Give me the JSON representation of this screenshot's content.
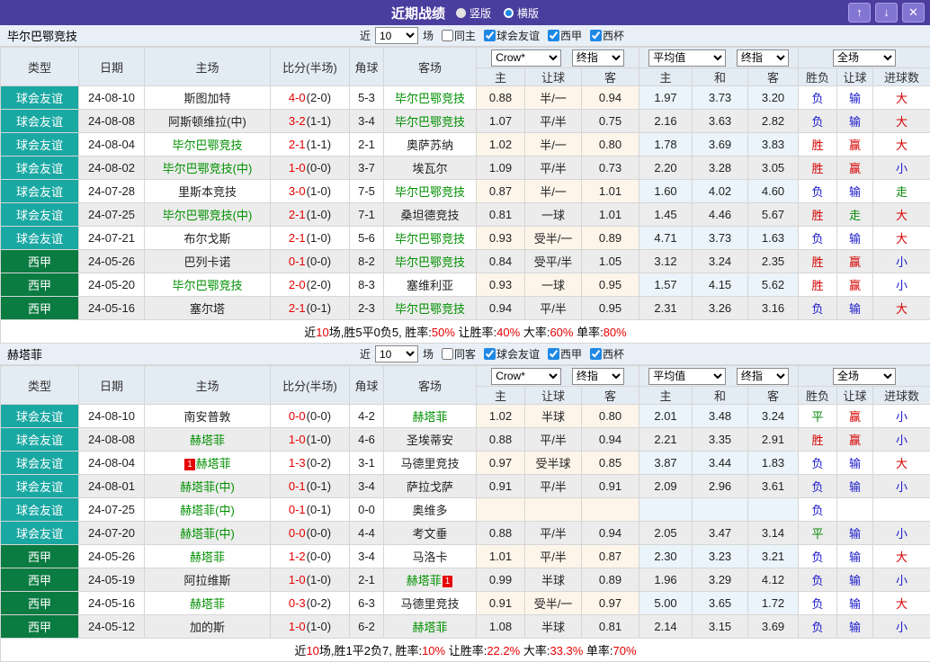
{
  "titlebar": {
    "title": "近期战绩",
    "view_options": [
      {
        "label": "竖版",
        "selected": false
      },
      {
        "label": "横版",
        "selected": true
      }
    ],
    "buttons": {
      "up": "↑",
      "down": "↓",
      "close": "✕"
    }
  },
  "filters": {
    "near_label": "近",
    "count": "10",
    "games_label": "场",
    "leagues": [
      "球会友谊",
      "西甲",
      "西杯"
    ]
  },
  "headers": {
    "columns": [
      "类型",
      "日期",
      "主场",
      "比分(半场)",
      "角球",
      "客场",
      "主",
      "让球",
      "客",
      "主",
      "和",
      "客",
      "胜负",
      "让球",
      "进球数"
    ],
    "selects": {
      "book": "Crow*",
      "book_final": "终指",
      "avg": "平均值",
      "avg_final": "终指",
      "scope": "全场"
    }
  },
  "colors": {
    "titlebar_bg": "#4a3d9e",
    "accent_blue": "#1e88e5",
    "team_link_green": "#009000",
    "score_red": "#e60000",
    "result_red": "#d60000",
    "result_blue": "#1a1acc",
    "result_green": "#0a8a0a"
  },
  "league_colors": {
    "球会友谊": "#1aa8a3",
    "西甲": "#0a7b41"
  },
  "teams": [
    {
      "name": "毕尔巴鄂竞技",
      "same_label": "同主",
      "rows": [
        {
          "league": "球会友谊",
          "date": "24-08-10",
          "home": "斯图加特",
          "hg": false,
          "hb": "",
          "ft": "4-0",
          "ht": "(2-0)",
          "corner": "5-3",
          "away": "毕尔巴鄂竞技",
          "ag": true,
          "ab": "",
          "odds": [
            "0.88",
            "半/一",
            "0.94"
          ],
          "avg": [
            "1.97",
            "3.73",
            "3.20"
          ],
          "res": [
            [
              "负",
              "blue"
            ],
            [
              "输",
              "blue"
            ],
            [
              "大",
              "red"
            ]
          ]
        },
        {
          "league": "球会友谊",
          "date": "24-08-08",
          "home": "阿斯顿维拉(中)",
          "hg": false,
          "hb": "",
          "ft": "3-2",
          "ht": "(1-1)",
          "corner": "3-4",
          "away": "毕尔巴鄂竞技",
          "ag": true,
          "ab": "",
          "odds": [
            "1.07",
            "平/半",
            "0.75"
          ],
          "avg": [
            "2.16",
            "3.63",
            "2.82"
          ],
          "res": [
            [
              "负",
              "blue"
            ],
            [
              "输",
              "blue"
            ],
            [
              "大",
              "red"
            ]
          ]
        },
        {
          "league": "球会友谊",
          "date": "24-08-04",
          "home": "毕尔巴鄂竞技",
          "hg": true,
          "hb": "",
          "ft": "2-1",
          "ht": "(1-1)",
          "corner": "2-1",
          "away": "奥萨苏纳",
          "ag": false,
          "ab": "",
          "odds": [
            "1.02",
            "半/一",
            "0.80"
          ],
          "avg": [
            "1.78",
            "3.69",
            "3.83"
          ],
          "res": [
            [
              "胜",
              "red"
            ],
            [
              "赢",
              "red"
            ],
            [
              "大",
              "red"
            ]
          ]
        },
        {
          "league": "球会友谊",
          "date": "24-08-02",
          "home": "毕尔巴鄂竞技(中)",
          "hg": true,
          "hb": "",
          "ft": "1-0",
          "ht": "(0-0)",
          "corner": "3-7",
          "away": "埃瓦尔",
          "ag": false,
          "ab": "",
          "odds": [
            "1.09",
            "平/半",
            "0.73"
          ],
          "avg": [
            "2.20",
            "3.28",
            "3.05"
          ],
          "res": [
            [
              "胜",
              "red"
            ],
            [
              "赢",
              "red"
            ],
            [
              "小",
              "blue"
            ]
          ]
        },
        {
          "league": "球会友谊",
          "date": "24-07-28",
          "home": "里斯本竞技",
          "hg": false,
          "hb": "",
          "ft": "3-0",
          "ht": "(1-0)",
          "corner": "7-5",
          "away": "毕尔巴鄂竞技",
          "ag": true,
          "ab": "",
          "odds": [
            "0.87",
            "半/一",
            "1.01"
          ],
          "avg": [
            "1.60",
            "4.02",
            "4.60"
          ],
          "res": [
            [
              "负",
              "blue"
            ],
            [
              "输",
              "blue"
            ],
            [
              "走",
              "green"
            ]
          ]
        },
        {
          "league": "球会友谊",
          "date": "24-07-25",
          "home": "毕尔巴鄂竞技(中)",
          "hg": true,
          "hb": "",
          "ft": "2-1",
          "ht": "(1-0)",
          "corner": "7-1",
          "away": "桑坦德竞技",
          "ag": false,
          "ab": "",
          "odds": [
            "0.81",
            "一球",
            "1.01"
          ],
          "avg": [
            "1.45",
            "4.46",
            "5.67"
          ],
          "res": [
            [
              "胜",
              "red"
            ],
            [
              "走",
              "green"
            ],
            [
              "大",
              "red"
            ]
          ]
        },
        {
          "league": "球会友谊",
          "date": "24-07-21",
          "home": "布尔戈斯",
          "hg": false,
          "hb": "",
          "ft": "2-1",
          "ht": "(1-0)",
          "corner": "5-6",
          "away": "毕尔巴鄂竞技",
          "ag": true,
          "ab": "",
          "odds": [
            "0.93",
            "受半/一",
            "0.89"
          ],
          "avg": [
            "4.71",
            "3.73",
            "1.63"
          ],
          "res": [
            [
              "负",
              "blue"
            ],
            [
              "输",
              "blue"
            ],
            [
              "大",
              "red"
            ]
          ]
        },
        {
          "league": "西甲",
          "date": "24-05-26",
          "home": "巴列卡诺",
          "hg": false,
          "hb": "",
          "ft": "0-1",
          "ht": "(0-0)",
          "corner": "8-2",
          "away": "毕尔巴鄂竞技",
          "ag": true,
          "ab": "",
          "odds": [
            "0.84",
            "受平/半",
            "1.05"
          ],
          "avg": [
            "3.12",
            "3.24",
            "2.35"
          ],
          "res": [
            [
              "胜",
              "red"
            ],
            [
              "赢",
              "red"
            ],
            [
              "小",
              "blue"
            ]
          ]
        },
        {
          "league": "西甲",
          "date": "24-05-20",
          "home": "毕尔巴鄂竞技",
          "hg": true,
          "hb": "",
          "ft": "2-0",
          "ht": "(2-0)",
          "corner": "8-3",
          "away": "塞维利亚",
          "ag": false,
          "ab": "",
          "odds": [
            "0.93",
            "一球",
            "0.95"
          ],
          "avg": [
            "1.57",
            "4.15",
            "5.62"
          ],
          "res": [
            [
              "胜",
              "red"
            ],
            [
              "赢",
              "red"
            ],
            [
              "小",
              "blue"
            ]
          ]
        },
        {
          "league": "西甲",
          "date": "24-05-16",
          "home": "塞尔塔",
          "hg": false,
          "hb": "",
          "ft": "2-1",
          "ht": "(0-1)",
          "corner": "2-3",
          "away": "毕尔巴鄂竞技",
          "ag": true,
          "ab": "",
          "odds": [
            "0.94",
            "平/半",
            "0.95"
          ],
          "avg": [
            "2.31",
            "3.26",
            "3.16"
          ],
          "res": [
            [
              "负",
              "blue"
            ],
            [
              "输",
              "blue"
            ],
            [
              "大",
              "red"
            ]
          ]
        }
      ],
      "summary": [
        [
          "近",
          0
        ],
        [
          "10",
          1
        ],
        [
          "场,胜5平0负5, 胜率:",
          0
        ],
        [
          "50%",
          1
        ],
        [
          " 让胜率:",
          0
        ],
        [
          "40%",
          1
        ],
        [
          " 大率:",
          0
        ],
        [
          "60%",
          1
        ],
        [
          " 单率:",
          0
        ],
        [
          "80%",
          1
        ]
      ]
    },
    {
      "name": "赫塔菲",
      "same_label": "同客",
      "rows": [
        {
          "league": "球会友谊",
          "date": "24-08-10",
          "home": "南安普敦",
          "hg": false,
          "hb": "",
          "ft": "0-0",
          "ht": "(0-0)",
          "corner": "4-2",
          "away": "赫塔菲",
          "ag": true,
          "ab": "",
          "odds": [
            "1.02",
            "半球",
            "0.80"
          ],
          "avg": [
            "2.01",
            "3.48",
            "3.24"
          ],
          "res": [
            [
              "平",
              "green"
            ],
            [
              "赢",
              "red"
            ],
            [
              "小",
              "blue"
            ]
          ]
        },
        {
          "league": "球会友谊",
          "date": "24-08-08",
          "home": "赫塔菲",
          "hg": true,
          "hb": "",
          "ft": "1-0",
          "ht": "(1-0)",
          "corner": "4-6",
          "away": "圣埃蒂安",
          "ag": false,
          "ab": "",
          "odds": [
            "0.88",
            "平/半",
            "0.94"
          ],
          "avg": [
            "2.21",
            "3.35",
            "2.91"
          ],
          "res": [
            [
              "胜",
              "red"
            ],
            [
              "赢",
              "red"
            ],
            [
              "小",
              "blue"
            ]
          ]
        },
        {
          "league": "球会友谊",
          "date": "24-08-04",
          "home": "赫塔菲",
          "hg": true,
          "hb": "1",
          "ft": "1-3",
          "ht": "(0-2)",
          "corner": "3-1",
          "away": "马德里竞技",
          "ag": false,
          "ab": "",
          "odds": [
            "0.97",
            "受半球",
            "0.85"
          ],
          "avg": [
            "3.87",
            "3.44",
            "1.83"
          ],
          "res": [
            [
              "负",
              "blue"
            ],
            [
              "输",
              "blue"
            ],
            [
              "大",
              "red"
            ]
          ]
        },
        {
          "league": "球会友谊",
          "date": "24-08-01",
          "home": "赫塔菲(中)",
          "hg": true,
          "hb": "",
          "ft": "0-1",
          "ht": "(0-1)",
          "corner": "3-4",
          "away": "萨拉戈萨",
          "ag": false,
          "ab": "",
          "odds": [
            "0.91",
            "平/半",
            "0.91"
          ],
          "avg": [
            "2.09",
            "2.96",
            "3.61"
          ],
          "res": [
            [
              "负",
              "blue"
            ],
            [
              "输",
              "blue"
            ],
            [
              "小",
              "blue"
            ]
          ]
        },
        {
          "league": "球会友谊",
          "date": "24-07-25",
          "home": "赫塔菲(中)",
          "hg": true,
          "hb": "",
          "ft": "0-1",
          "ht": "(0-1)",
          "corner": "0-0",
          "away": "奥维多",
          "ag": false,
          "ab": "",
          "odds": [
            "",
            "",
            ""
          ],
          "avg": [
            "",
            "",
            ""
          ],
          "res": [
            [
              "负",
              "blue"
            ],
            [
              "",
              ""
            ],
            [
              "",
              ""
            ]
          ]
        },
        {
          "league": "球会友谊",
          "date": "24-07-20",
          "home": "赫塔菲(中)",
          "hg": true,
          "hb": "",
          "ft": "0-0",
          "ht": "(0-0)",
          "corner": "4-4",
          "away": "考文垂",
          "ag": false,
          "ab": "",
          "odds": [
            "0.88",
            "平/半",
            "0.94"
          ],
          "avg": [
            "2.05",
            "3.47",
            "3.14"
          ],
          "res": [
            [
              "平",
              "green"
            ],
            [
              "输",
              "blue"
            ],
            [
              "小",
              "blue"
            ]
          ]
        },
        {
          "league": "西甲",
          "date": "24-05-26",
          "home": "赫塔菲",
          "hg": true,
          "hb": "",
          "ft": "1-2",
          "ht": "(0-0)",
          "corner": "3-4",
          "away": "马洛卡",
          "ag": false,
          "ab": "",
          "odds": [
            "1.01",
            "平/半",
            "0.87"
          ],
          "avg": [
            "2.30",
            "3.23",
            "3.21"
          ],
          "res": [
            [
              "负",
              "blue"
            ],
            [
              "输",
              "blue"
            ],
            [
              "大",
              "red"
            ]
          ]
        },
        {
          "league": "西甲",
          "date": "24-05-19",
          "home": "阿拉维斯",
          "hg": false,
          "hb": "",
          "ft": "1-0",
          "ht": "(1-0)",
          "corner": "2-1",
          "away": "赫塔菲",
          "ag": true,
          "ab": "1",
          "odds": [
            "0.99",
            "半球",
            "0.89"
          ],
          "avg": [
            "1.96",
            "3.29",
            "4.12"
          ],
          "res": [
            [
              "负",
              "blue"
            ],
            [
              "输",
              "blue"
            ],
            [
              "小",
              "blue"
            ]
          ]
        },
        {
          "league": "西甲",
          "date": "24-05-16",
          "home": "赫塔菲",
          "hg": true,
          "hb": "",
          "ft": "0-3",
          "ht": "(0-2)",
          "corner": "6-3",
          "away": "马德里竞技",
          "ag": false,
          "ab": "",
          "odds": [
            "0.91",
            "受半/一",
            "0.97"
          ],
          "avg": [
            "5.00",
            "3.65",
            "1.72"
          ],
          "res": [
            [
              "负",
              "blue"
            ],
            [
              "输",
              "blue"
            ],
            [
              "大",
              "red"
            ]
          ]
        },
        {
          "league": "西甲",
          "date": "24-05-12",
          "home": "加的斯",
          "hg": false,
          "hb": "",
          "ft": "1-0",
          "ht": "(1-0)",
          "corner": "6-2",
          "away": "赫塔菲",
          "ag": true,
          "ab": "",
          "odds": [
            "1.08",
            "半球",
            "0.81"
          ],
          "avg": [
            "2.14",
            "3.15",
            "3.69"
          ],
          "res": [
            [
              "负",
              "blue"
            ],
            [
              "输",
              "blue"
            ],
            [
              "小",
              "blue"
            ]
          ]
        }
      ],
      "summary": [
        [
          "近",
          0
        ],
        [
          "10",
          1
        ],
        [
          "场,胜1平2负7, 胜率:",
          0
        ],
        [
          "10%",
          1
        ],
        [
          " 让胜率:",
          0
        ],
        [
          "22.2%",
          1
        ],
        [
          " 大率:",
          0
        ],
        [
          "33.3%",
          1
        ],
        [
          " 单率:",
          0
        ],
        [
          "70%",
          1
        ]
      ]
    }
  ]
}
